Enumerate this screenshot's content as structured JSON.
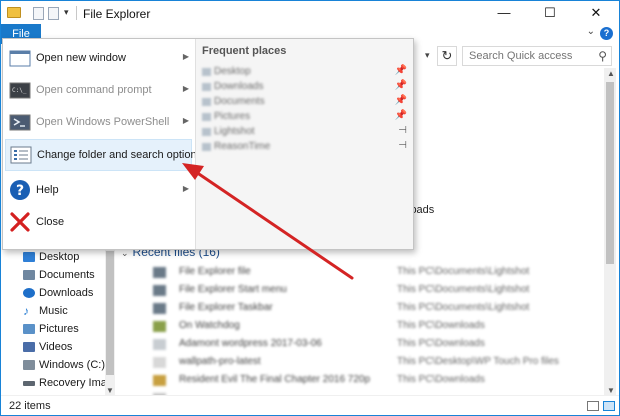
{
  "window": {
    "title": "File Explorer",
    "minimize": "—",
    "maximize": "☐",
    "close": "✕"
  },
  "ribbon": {
    "file_tab": "File",
    "help": "?"
  },
  "search": {
    "placeholder": "Search Quick access"
  },
  "menu": {
    "items": [
      {
        "label": "Open new window",
        "icon": "window-icon",
        "has_arrow": true
      },
      {
        "label": "Open command prompt",
        "icon": "command-prompt-icon",
        "has_arrow": true,
        "disabled": true
      },
      {
        "label": "Open Windows PowerShell",
        "icon": "powershell-icon",
        "has_arrow": true,
        "disabled": true
      },
      {
        "label": "Change folder and search options",
        "icon": "folder-options-icon",
        "has_arrow": false,
        "highlighted": true
      },
      {
        "label": "Help",
        "icon": "help-icon",
        "has_arrow": true
      },
      {
        "label": "Close",
        "icon": "close-x-icon",
        "has_arrow": false
      }
    ],
    "frequent_title": "Frequent places",
    "frequent": [
      {
        "name": "Desktop",
        "pin": "📌"
      },
      {
        "name": "Downloads",
        "pin": "📌"
      },
      {
        "name": "Documents",
        "pin": "📌"
      },
      {
        "name": "Pictures",
        "pin": "📌"
      },
      {
        "name": "Lightshot",
        "pin": "⊣"
      },
      {
        "name": "ReasonTime",
        "pin": "⊣"
      }
    ]
  },
  "nav": {
    "items": [
      {
        "label": "Desktop",
        "color": "#2f7fd6"
      },
      {
        "label": "Documents",
        "color": "#6f87a0"
      },
      {
        "label": "Downloads",
        "color": "#1e6fc9"
      },
      {
        "label": "Music",
        "color": "#2b7fd3"
      },
      {
        "label": "Pictures",
        "color": "#5a91c8"
      },
      {
        "label": "Videos",
        "color": "#4a6da8"
      },
      {
        "label": "Windows (C:)",
        "color": "#7f8d9b"
      },
      {
        "label": "Recovery Ima",
        "color": "#5d6670"
      }
    ]
  },
  "main": {
    "partial_downloads": "loads",
    "recent_header": "Recent files (16)",
    "recent": [
      {
        "name": "File Explorer file",
        "path": "This PC\\Documents\\Lightshot"
      },
      {
        "name": "File Explorer Start menu",
        "path": "This PC\\Documents\\Lightshot"
      },
      {
        "name": "File Explorer Taskbar",
        "path": "This PC\\Documents\\Lightshot"
      },
      {
        "name": "On Watchdog",
        "path": "This PC\\Downloads"
      },
      {
        "name": "Adamont wordpress 2017-03-06",
        "path": "This PC\\Downloads"
      },
      {
        "name": "wallpath-pro-latest",
        "path": "This PC\\Desktop\\WP Touch Pro files"
      },
      {
        "name": "Resident Evil The Final Chapter 2016 720p",
        "path": "This PC\\Downloads"
      },
      {
        "name": "",
        "path": ""
      }
    ]
  },
  "status": {
    "count": "22 items"
  },
  "colors": {
    "accent": "#1979ca",
    "arrow": "#d42424",
    "highlight": "#e5f1fb"
  }
}
